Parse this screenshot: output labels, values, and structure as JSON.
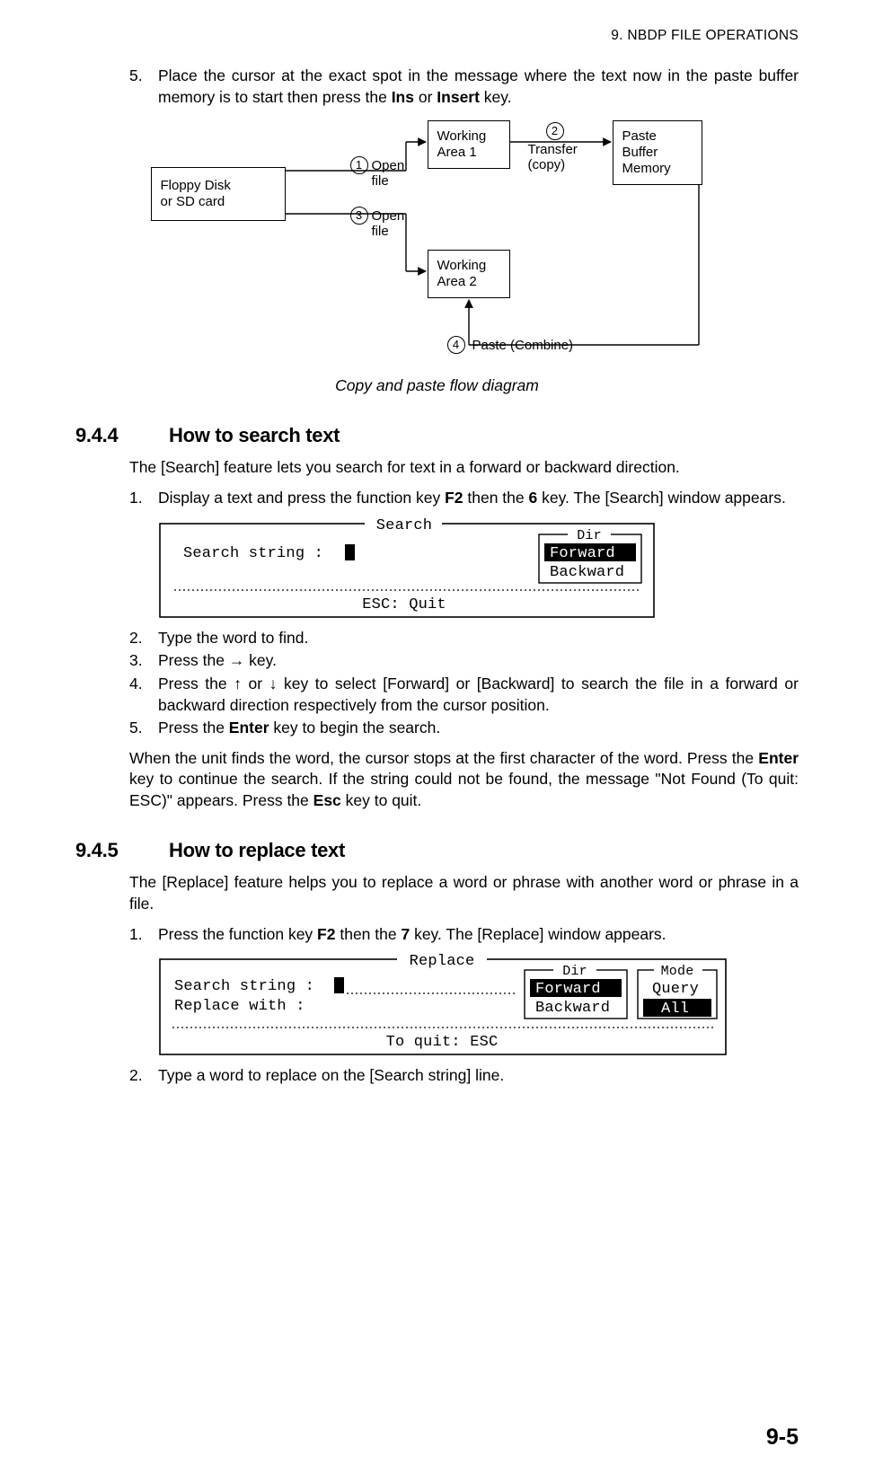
{
  "header": {
    "right": "9.  NBDP FILE OPERATIONS"
  },
  "page_number": "9-5",
  "step5": {
    "num": "5.",
    "text_a": "Place the cursor at the exact spot in the message where the text now in the paste buffer memory is to start then press the ",
    "bold1": "Ins",
    "text_b": " or ",
    "bold2": "Insert",
    "text_c": " key."
  },
  "diagram": {
    "floppy": "Floppy Disk\nor SD card",
    "open_file": "Open\nfile",
    "wa1": "Working\nArea 1",
    "wa2": "Working\nArea 2",
    "paste_buf": "Paste\nBuffer\nMemory",
    "transfer": "Transfer\n(copy)",
    "paste_combine": "Paste (Combine)",
    "n1": "1",
    "n2": "2",
    "n3": "3",
    "n4": "4"
  },
  "diagram_caption": "Copy and paste flow diagram",
  "sec_944": {
    "num": "9.4.4",
    "title": "How to search text"
  },
  "p_944_intro": "The [Search] feature lets you search for text in a forward or backward direction.",
  "p_944_s1": {
    "num": "1.",
    "a": "Display a text and press the function key ",
    "b1": "F2",
    "mid": " then the ",
    "b2": "6",
    "c": " key. The [Search] window appears."
  },
  "search_dialog": {
    "title": "Search",
    "label": "Search string :",
    "dir_title": "Dir",
    "forward": "Forward",
    "backward": "Backward",
    "esc": "ESC: Quit"
  },
  "p_944_s2": {
    "num": "2.",
    "text": "Type the word to find."
  },
  "p_944_s3": {
    "num": "3.",
    "a": "Press the ",
    "arrow": "→",
    "b": " key."
  },
  "p_944_s4": {
    "num": "4.",
    "a": "Press the ",
    "u": "↑",
    "mid": " or ",
    "d": "↓",
    "b": " key to select [Forward] or [Backward] to search the file in a forward or backward direction respectively from the cursor position."
  },
  "p_944_s5": {
    "num": "5.",
    "a": "Press the ",
    "b": "Enter",
    "c": " key to begin the search."
  },
  "p_944_post": {
    "a": "When the unit finds the word, the cursor stops at the first character of the word. Press the ",
    "b1": "Enter",
    "mid": " key to continue the search. If the string could not be found, the message \"Not Found (To quit: ESC)\" appears. Press the ",
    "b2": "Esc",
    "c": " key to quit."
  },
  "sec_945": {
    "num": "9.4.5",
    "title": "How to replace text"
  },
  "p_945_intro": "The [Replace] feature helps you to replace a word or phrase with another word or phrase in a file.",
  "p_945_s1": {
    "num": "1.",
    "a": "Press the function key ",
    "b1": "F2",
    "mid": " then the ",
    "b2": "7",
    "c": " key. The [Replace] window appears."
  },
  "replace_dialog": {
    "title": "Replace",
    "search": "Search string :",
    "replace": "Replace with  :",
    "dir_title": "Dir",
    "forward": "Forward",
    "backward": "Backward",
    "mode_title": "Mode",
    "query": "Query",
    "all": "All",
    "quit": "To quit: ESC"
  },
  "p_945_s2": {
    "num": "2.",
    "text": "Type a word to replace on the [Search string] line."
  }
}
